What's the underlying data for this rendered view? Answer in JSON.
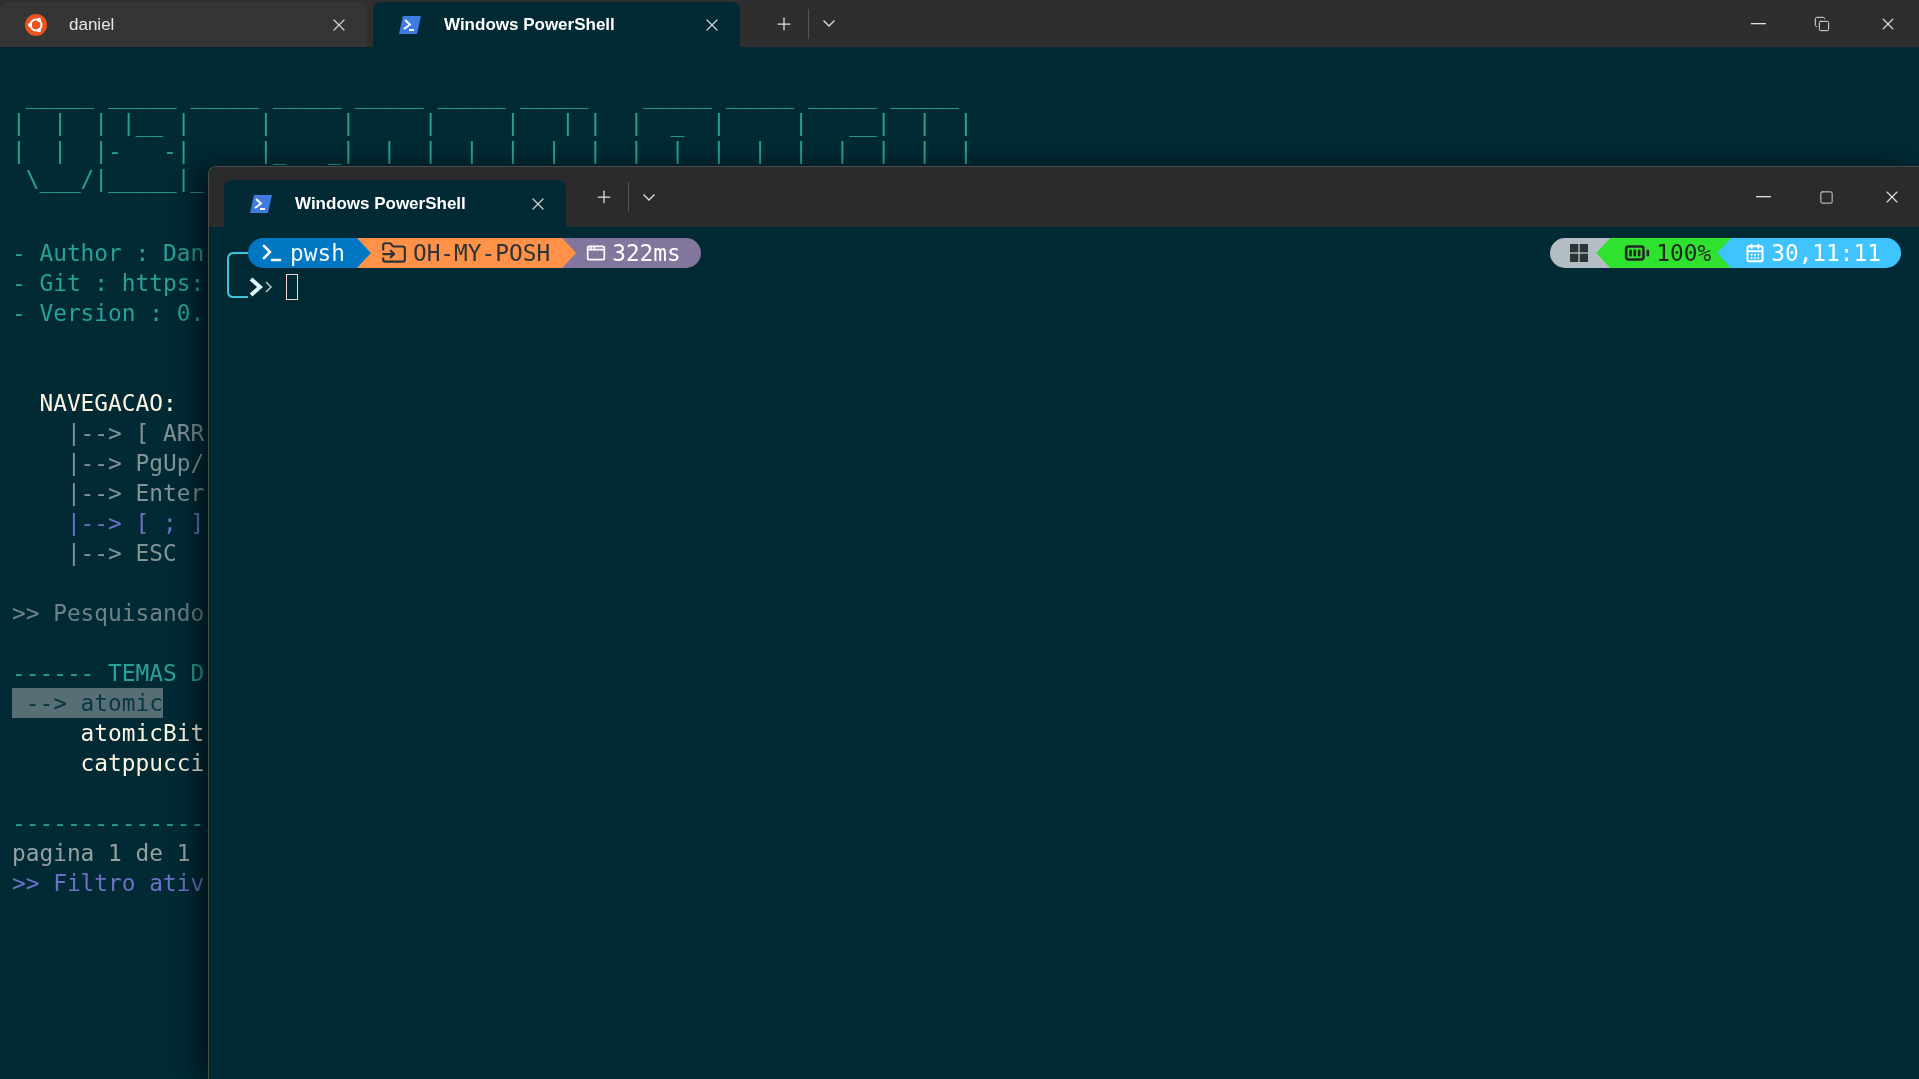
{
  "outer_tabs": [
    {
      "title": "daniel",
      "kind": "ubuntu",
      "selected": false
    },
    {
      "title": "Windows PowerShell",
      "kind": "powershell",
      "selected": true
    }
  ],
  "terminal": {
    "banner": [
      " _____ _____ _____ _____ _____ _____ _____    _____ _____ _____ _____",
      "|  |  | |__ |     |     |     |     |   | |  |  _  |     |   __|  |  |",
      "|  |  |-   -|     |_   _|  |  |  |  |  |  |  |  |  |  |  |  |  |  |  |",
      " \\___/|_____|_"
    ],
    "rows": [
      {
        "kind": "blank"
      },
      {
        "kind": "info",
        "text": "- Author : Dan"
      },
      {
        "kind": "info",
        "text": "- Git : https:"
      },
      {
        "kind": "info",
        "text": "- Version : 0."
      },
      {
        "kind": "blank"
      },
      {
        "kind": "blank"
      },
      {
        "kind": "heading",
        "text": "NAVEGACAO:"
      },
      {
        "kind": "nav",
        "text": "|--> [ ARR"
      },
      {
        "kind": "nav",
        "text": "|--> PgUp/"
      },
      {
        "kind": "nav",
        "text": "|--> Enter"
      },
      {
        "kind": "nav_hint",
        "text": "|--> [ ; ]"
      },
      {
        "kind": "nav",
        "text": "|--> ESC"
      },
      {
        "kind": "blank"
      },
      {
        "kind": "status",
        "text": ">> Pesquisando"
      },
      {
        "kind": "blank"
      },
      {
        "kind": "section",
        "text": "------ TEMAS D"
      },
      {
        "kind": "theme",
        "text": "--> atomic",
        "selected": true
      },
      {
        "kind": "theme",
        "text": "atomicBit",
        "selected": false
      },
      {
        "kind": "theme",
        "text": "catppucci",
        "selected": false
      },
      {
        "kind": "blank"
      },
      {
        "kind": "rule",
        "text": "--------------"
      },
      {
        "kind": "footer",
        "text": "pagina 1 de 1"
      },
      {
        "kind": "filter",
        "text": ">> Filtro ativ"
      }
    ]
  },
  "inner_window": {
    "tabs": [
      {
        "title": "Windows PowerShell",
        "kind": "powershell",
        "selected": true
      }
    ],
    "prompt": {
      "left_segments": [
        {
          "kind": "shell",
          "text": "pwsh",
          "color": "#0077c2"
        },
        {
          "kind": "path",
          "text": "OH-MY-POSH",
          "color": "#ff9248"
        },
        {
          "kind": "time",
          "text": "322ms",
          "color": "#83769c"
        }
      ],
      "right_segments": [
        {
          "kind": "os",
          "color": "#b2bec3"
        },
        {
          "kind": "battery",
          "text": "100%",
          "color": "#2ee22e"
        },
        {
          "kind": "date",
          "text": "30,11:11",
          "color": "#40c4ff"
        }
      ]
    }
  }
}
